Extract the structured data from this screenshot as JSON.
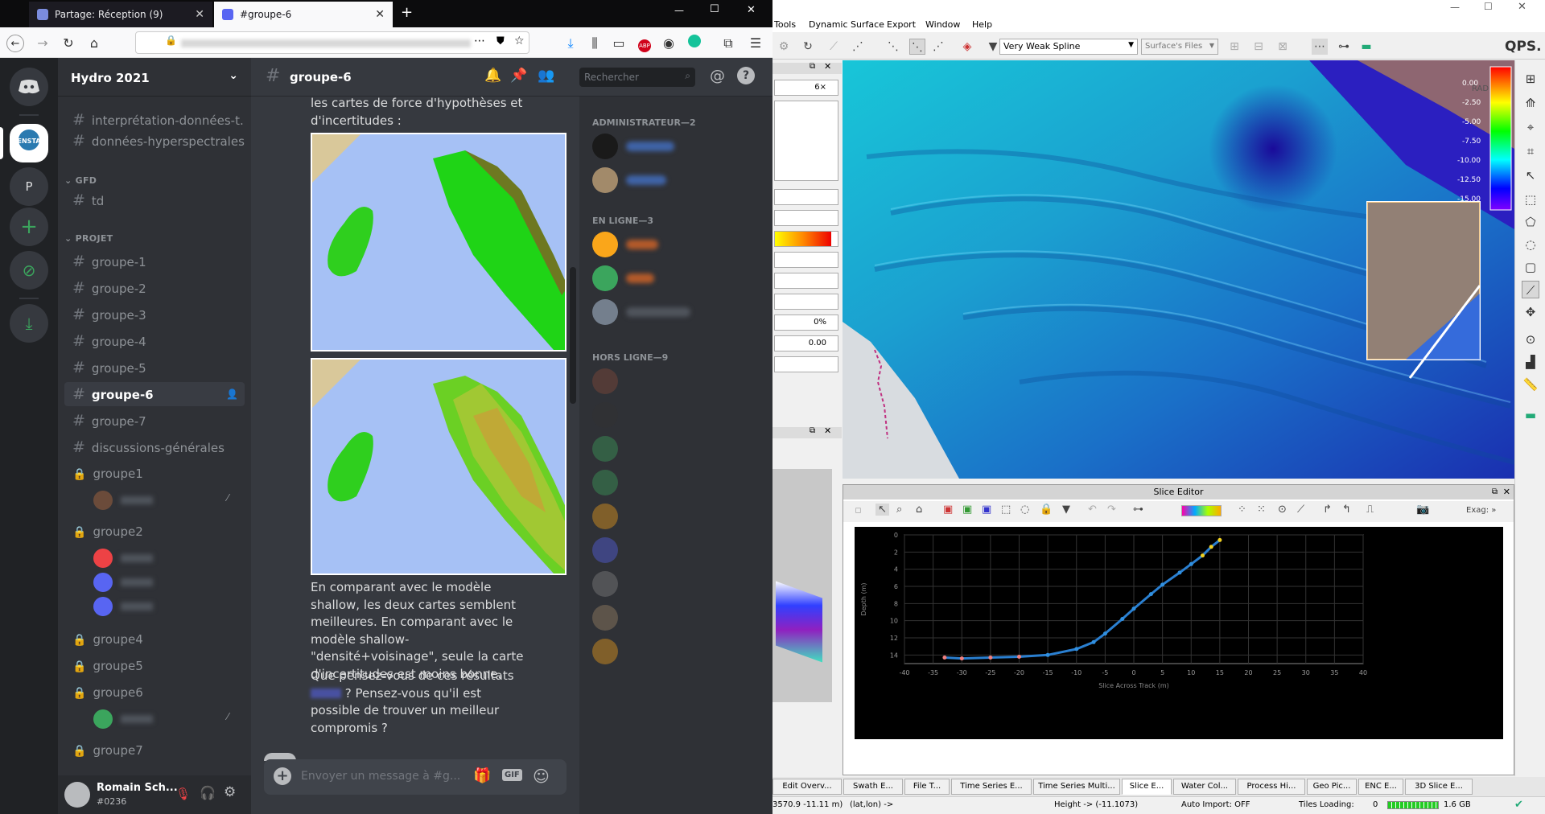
{
  "browser": {
    "tabs": [
      {
        "title": "Partage: Réception (9)",
        "active": false
      },
      {
        "title": "#groupe-6",
        "active": true
      }
    ],
    "new_tab": "+",
    "window_controls": [
      "—",
      "☐",
      "✕"
    ]
  },
  "discord": {
    "server_name": "Hydro 2021",
    "server_badge": "ENSTA Bretagne",
    "server_p": "P",
    "channels_top": [
      "interprétation-données-t...",
      "données-hyperspectrales"
    ],
    "categories": {
      "gfd": "GFD",
      "projet": "PROJET"
    },
    "gfd_channels": [
      "td"
    ],
    "projet_channels": [
      "groupe-1",
      "groupe-2",
      "groupe-3",
      "groupe-4",
      "groupe-5",
      "groupe-6",
      "groupe-7",
      "discussions-générales"
    ],
    "voice_channels": [
      "groupe1",
      "groupe2",
      "groupe4",
      "groupe5",
      "groupe6",
      "groupe7"
    ],
    "user": {
      "name": "Romain Sch...",
      "tag": "#0236"
    },
    "channel_title": "groupe-6",
    "search_placeholder": "Rechercher",
    "messages": {
      "m1": "les cartes de force d'hypothèses et d'incertitudes :",
      "m2": "En comparant avec le modèle shallow, les deux cartes semblent meilleures. En comparant avec le modèle shallow-\"densité+voisinage\", seule la carte d'incertitudes est moins bonne.",
      "m3a": "Que pensez-vous de ces résultats",
      "m3b": "? Pensez-vous qu'il est possible de trouver un meilleur compromis ?",
      "composer_placeholder": "Envoyer un message à #g..."
    },
    "members": {
      "admin": "ADMINISTRATEUR—2",
      "online": "EN LIGNE—3",
      "offline": "HORS LIGNE—9"
    },
    "colors": {
      "bg": "#36393f",
      "sidebar": "#2f3136",
      "accent": "#5865f2",
      "online": "#3ba55d"
    }
  },
  "qps": {
    "menu": [
      "Tools",
      "Dynamic Surface",
      "Export",
      "Window",
      "Help"
    ],
    "logo": "QPS.",
    "spline_select": "Very Weak Spline",
    "surface_files": "Surface's Files",
    "left_fields": [
      "6×",
      "0%",
      "0.00"
    ],
    "colorbar_labels": [
      "0.00",
      "-2.50",
      "-5.00",
      "-7.50",
      "-10.00",
      "-12.50",
      "-15.00"
    ],
    "corner_label": "RAD",
    "slice_editor": {
      "title": "Slice Editor",
      "exag": "Exag: »",
      "ylabel": "Depth (m)",
      "xlabel": "Slice Across Track (m)",
      "yticks": [
        "0",
        "2",
        "4",
        "6",
        "8",
        "10",
        "12",
        "14"
      ],
      "xticks": [
        "-40",
        "-35",
        "-30",
        "-25",
        "-20",
        "-15",
        "-10",
        "-5",
        "0",
        "5",
        "10",
        "15",
        "20",
        "25",
        "30",
        "35",
        "40"
      ]
    },
    "bottom_tabs": [
      "Edit Overv...",
      "Swath E...",
      "File T...",
      "Time Series E...",
      "Time Series Multi...",
      "Slice E...",
      "Water Col...",
      "Process Hi...",
      "Geo Pic...",
      "ENC E...",
      "3D Slice E..."
    ],
    "status": {
      "coords": "3570.9 -11.11 m)",
      "latlon": "(lat,lon) ->",
      "height": "Height -> (-11.1073)",
      "auto_import": "Auto Import: OFF",
      "tiles": "Tiles Loading:",
      "tiles_count": "0",
      "memory": "1.6 GB"
    }
  },
  "chart_data": {
    "type": "scatter",
    "title": "",
    "xlabel": "Slice Across Track (m)",
    "ylabel": "Depth (m)",
    "xlim": [
      -40,
      40
    ],
    "ylim": [
      0,
      15
    ],
    "inverted_y": true,
    "series": [
      {
        "x": [
          -33,
          -30,
          -25,
          -20,
          -15,
          -10,
          -7,
          -5,
          -2,
          0,
          3,
          5,
          8,
          10,
          12,
          13.5,
          15
        ],
        "y": [
          14.3,
          14.4,
          14.3,
          14.2,
          14.0,
          13.3,
          12.5,
          11.5,
          9.8,
          8.6,
          6.9,
          5.8,
          4.4,
          3.4,
          2.4,
          1.4,
          0.6
        ]
      }
    ]
  }
}
